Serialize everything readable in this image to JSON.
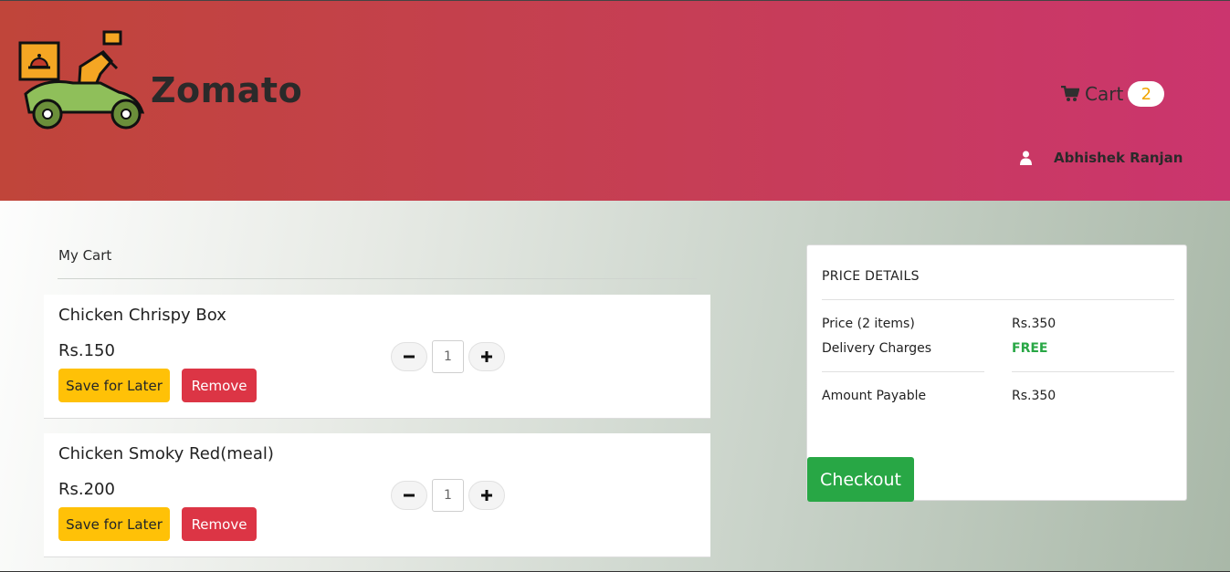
{
  "header": {
    "brand": "Zomato",
    "cart_label": "Cart",
    "cart_count": "2",
    "user_name": "Abhishek Ranjan"
  },
  "cart": {
    "title": "My Cart",
    "items": [
      {
        "name": "Chicken Chrispy Box",
        "price": "Rs.150",
        "quantity": "1",
        "save_label": "Save for Later",
        "remove_label": "Remove"
      },
      {
        "name": "Chicken Smoky Red(meal)",
        "price": "Rs.200",
        "quantity": "1",
        "save_label": "Save for Later",
        "remove_label": "Remove"
      }
    ]
  },
  "price_details": {
    "title": "PRICE DETAILS",
    "price_label": "Price (2 items)",
    "price_value": "Rs.350",
    "delivery_label": "Delivery Charges",
    "delivery_value": "FREE",
    "payable_label": "Amount Payable",
    "payable_value": "Rs.350",
    "checkout_label": "Checkout"
  },
  "icons": {
    "minus": "minus-icon",
    "plus": "plus-icon",
    "cart": "shopping-cart-icon",
    "user": "user-icon",
    "logo": "delivery-scooter-logo"
  },
  "colors": {
    "header_start": "#c0453a",
    "header_end": "#cb356e",
    "save_button": "#ffc107",
    "remove_button": "#dc3545",
    "checkout_button": "#28a745",
    "free_text": "#28a745",
    "badge_text": "#f0a500"
  }
}
